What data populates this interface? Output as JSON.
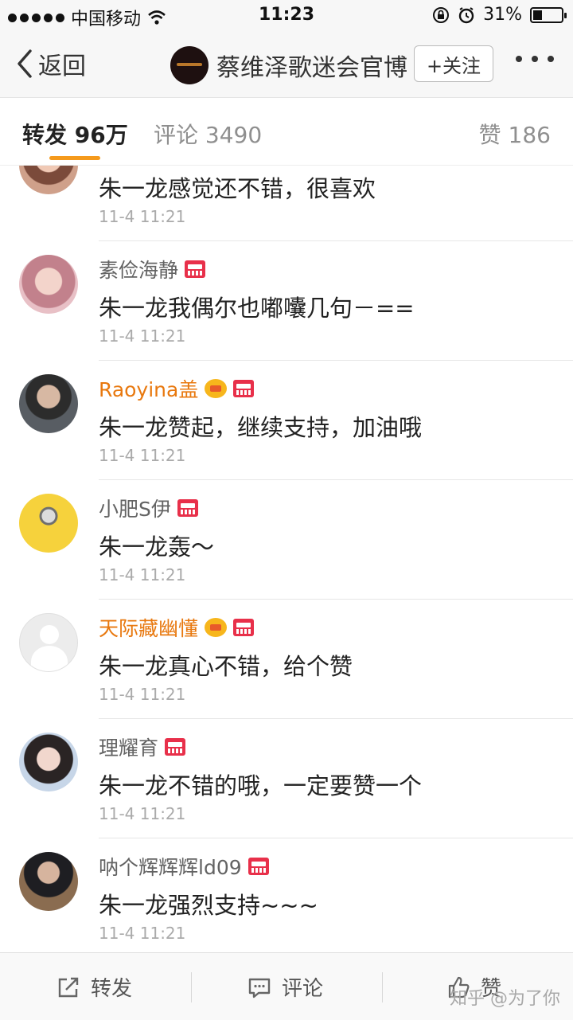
{
  "status_bar": {
    "carrier": "中国移动",
    "time": "11:23",
    "battery": "31%",
    "battery_level": 0.31
  },
  "nav": {
    "back_label": "返回",
    "title": "蔡维泽歌迷会官博",
    "follow_label": "+关注"
  },
  "tabs": {
    "repost": "转发 96万",
    "comments": "评论 3490",
    "likes": "赞 186",
    "active": "repost"
  },
  "comments": [
    {
      "name": "",
      "badges": [],
      "text": "朱一龙感觉还不错，很喜欢",
      "time": "11-4 11:21"
    },
    {
      "name": "素俭海静",
      "badges": [
        "vip"
      ],
      "text": "朱一龙我偶尔也嘟囔几句－==",
      "time": "11-4 11:21"
    },
    {
      "name": "Raoyina盖",
      "gold": true,
      "badges": [
        "crown",
        "vip"
      ],
      "text": "朱一龙赞起，继续支持，加油哦",
      "time": "11-4 11:21"
    },
    {
      "name": "小肥S伊",
      "badges": [
        "vip"
      ],
      "text": "朱一龙轰～",
      "time": "11-4 11:21"
    },
    {
      "name": "天际藏幽懂",
      "gold": true,
      "badges": [
        "crown",
        "vip"
      ],
      "text": "朱一龙真心不错，给个赞",
      "time": "11-4 11:21"
    },
    {
      "name": "理耀育",
      "badges": [
        "vip"
      ],
      "text": "朱一龙不错的哦，一定要赞一个",
      "time": "11-4 11:21"
    },
    {
      "name": "呐个辉辉辉ld09",
      "badges": [
        "vip"
      ],
      "text": "朱一龙强烈支持~~~",
      "time": "11-4 11:21"
    }
  ],
  "toolbar": {
    "repost": "转发",
    "comment": "评论",
    "like": "赞"
  },
  "watermark": "知乎 @为了你",
  "colors": {
    "accent_orange": "#f59a1c",
    "gold_name": "#e8780e",
    "vip_red": "#e8304a"
  }
}
